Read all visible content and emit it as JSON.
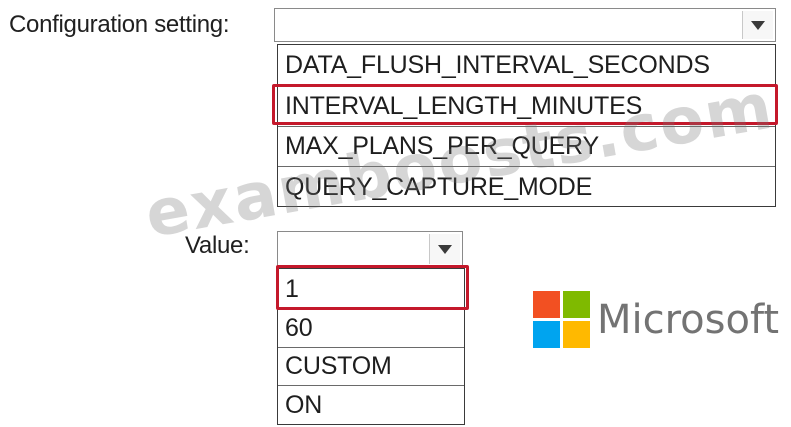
{
  "config": {
    "label": "Configuration setting:",
    "selected_value": "",
    "options": [
      "DATA_FLUSH_INTERVAL_SECONDS",
      "INTERVAL_LENGTH_MINUTES",
      "MAX_PLANS_PER_QUERY",
      "QUERY_CAPTURE_MODE"
    ],
    "highlighted_option": "INTERVAL_LENGTH_MINUTES"
  },
  "value": {
    "label": "Value:",
    "selected_value": "",
    "options": [
      "1",
      "60",
      "CUSTOM",
      "ON"
    ],
    "highlighted_option": "1"
  },
  "watermark": {
    "text": "examboosts.com"
  },
  "brand": {
    "name": "Microsoft",
    "logo_colors": [
      "#f25022",
      "#7fba00",
      "#00a4ef",
      "#ffb900"
    ]
  },
  "colors": {
    "highlight": "#c4182b"
  },
  "icons": {
    "dropdown": "triangle-down-icon"
  }
}
